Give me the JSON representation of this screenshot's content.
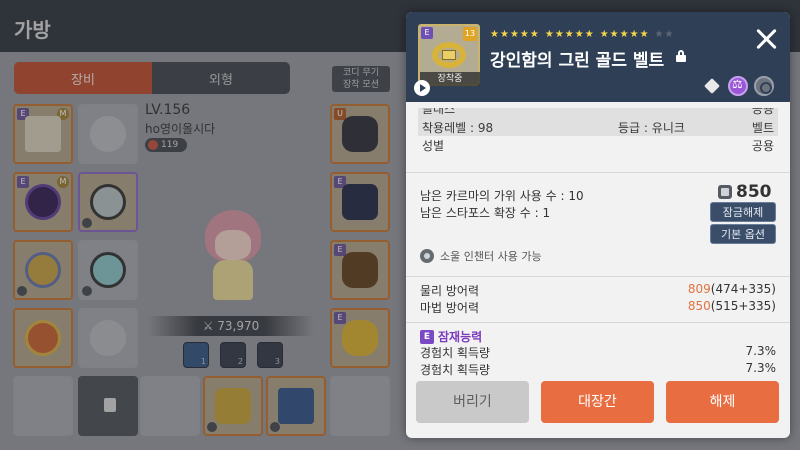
{
  "background": {
    "title": "가방",
    "tabs": [
      "장비",
      "외형"
    ],
    "coord_button": "코디 무기\n장착 모션",
    "character": {
      "level": "LV.156",
      "name": "ho영이올시다",
      "badge_count": "119",
      "combat_power": "73,970"
    },
    "presets": [
      "1",
      "2",
      "3"
    ]
  },
  "popup": {
    "equipped_label": "장착중",
    "item_name": "강인함의 그린 골드 벨트",
    "upgrade_count": "13",
    "stars": {
      "filled": 15,
      "total": 17
    },
    "requirements": {
      "cut_row": {
        "label": "클래스",
        "value": "공용"
      },
      "row1": {
        "label": "착용레벨 :",
        "level": "98",
        "grade_label": "등급 :",
        "grade": "유니크",
        "type": "벨트"
      },
      "row2": {
        "label": "성별",
        "value": "공용"
      }
    },
    "karma_text": "남은 카르마의 가위 사용 수 : 10",
    "starforce_text": "남은 스타포스 확장 수 : 1",
    "price": "850",
    "unlock_button": "잠금해제",
    "base_option_button": "기본 옵션",
    "soul_text": "소울 인챈터 사용 가능",
    "stats": [
      {
        "label": "물리 방어력",
        "hl": "809",
        "rest": "(474+335)"
      },
      {
        "label": "마법 방어력",
        "hl": "850",
        "rest": "(515+335)"
      }
    ],
    "potential_label": "잠재능력",
    "potentials": [
      {
        "label": "경험치 획득량",
        "value": "7.3%"
      },
      {
        "label": "경험치 획득량",
        "value": "7.3%"
      }
    ],
    "buttons": {
      "discard": "버리기",
      "storage": "대장간",
      "unequip": "해제"
    },
    "colors": {
      "accent": "#e86e42",
      "potential": "#7c3bbd",
      "header": "#2f3f55"
    }
  }
}
